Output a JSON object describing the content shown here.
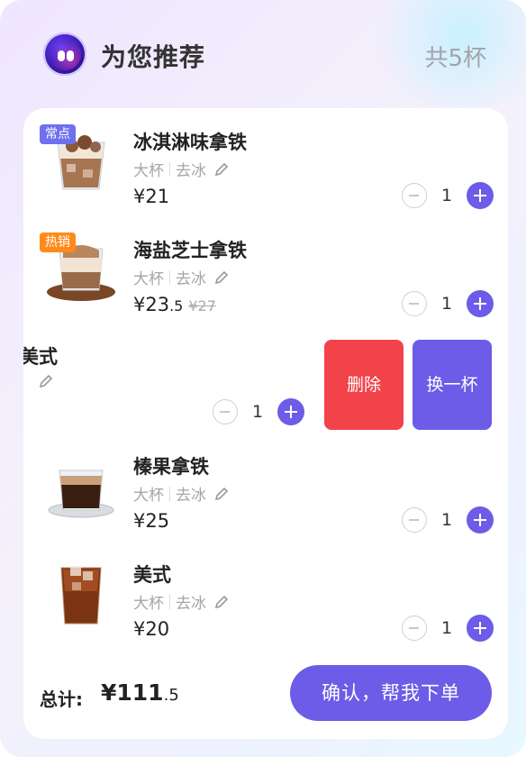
{
  "header": {
    "title": "为您推荐",
    "count": "共5杯"
  },
  "items": [
    {
      "tag": "常点",
      "name": "冰淇淋味拿铁",
      "size": "大杯",
      "ice": "去冰",
      "price_int": "¥21",
      "price_dec": "",
      "old_price": "",
      "qty": "1"
    },
    {
      "tag": "热销",
      "name": "海盐芝士拿铁",
      "size": "大杯",
      "ice": "去冰",
      "price_int": "¥23",
      "price_dec": ".5",
      "old_price": "¥27",
      "qty": "1"
    },
    {
      "tag": "",
      "name": "美式",
      "name_visible": "美式",
      "size": "",
      "ice": "",
      "price_int": "",
      "price_dec": "",
      "old_price": "",
      "qty": "1"
    },
    {
      "tag": "",
      "name": "榛果拿铁",
      "size": "大杯",
      "ice": "去冰",
      "price_int": "¥25",
      "price_dec": "",
      "old_price": "",
      "qty": "1"
    },
    {
      "tag": "",
      "name": "美式",
      "size": "大杯",
      "ice": "去冰",
      "price_int": "¥20",
      "price_dec": "",
      "old_price": "",
      "qty": "1"
    }
  ],
  "swipe_actions": {
    "delete": "删除",
    "swap": "换一杯"
  },
  "footer": {
    "total_label": "总计:",
    "total_int": "¥111",
    "total_dec": ".5",
    "confirm": "确认，帮我下单"
  },
  "colors": {
    "accent": "#6c5ce7",
    "delete": "#f2434a",
    "tag_blue": "#6e70ee",
    "tag_orange": "#ff8a1a"
  }
}
